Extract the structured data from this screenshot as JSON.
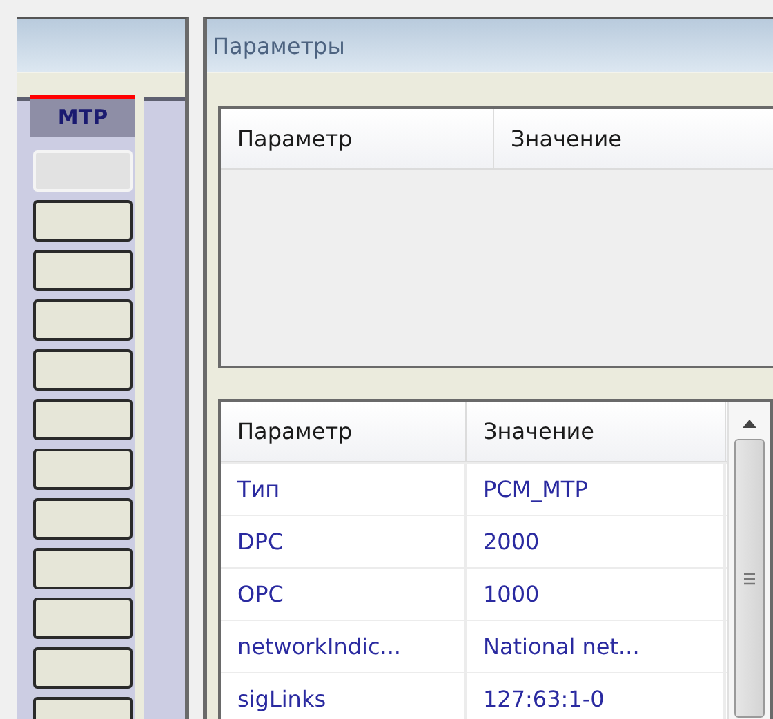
{
  "left_panel": {
    "column_header": "MTP",
    "slots": [
      {
        "disabled": true
      },
      {
        "disabled": false
      },
      {
        "disabled": false
      },
      {
        "disabled": false
      },
      {
        "disabled": false
      },
      {
        "disabled": false
      },
      {
        "disabled": false
      },
      {
        "disabled": false
      },
      {
        "disabled": false
      },
      {
        "disabled": false
      },
      {
        "disabled": false
      },
      {
        "disabled": false
      }
    ]
  },
  "right_panel": {
    "title": "Параметры",
    "top_table": {
      "columns": [
        "Параметр",
        "Значение"
      ]
    },
    "bottom_table": {
      "columns": [
        "Параметр",
        "Значение"
      ],
      "rows": [
        {
          "parameter": "Тип",
          "value": "PCM_MTP"
        },
        {
          "parameter": "DPC",
          "value": "2000"
        },
        {
          "parameter": "OPC",
          "value": "1000"
        },
        {
          "parameter": "networkIndic...",
          "value": "National net..."
        },
        {
          "parameter": "sigLinks",
          "value": "127:63:1-0"
        }
      ]
    }
  }
}
